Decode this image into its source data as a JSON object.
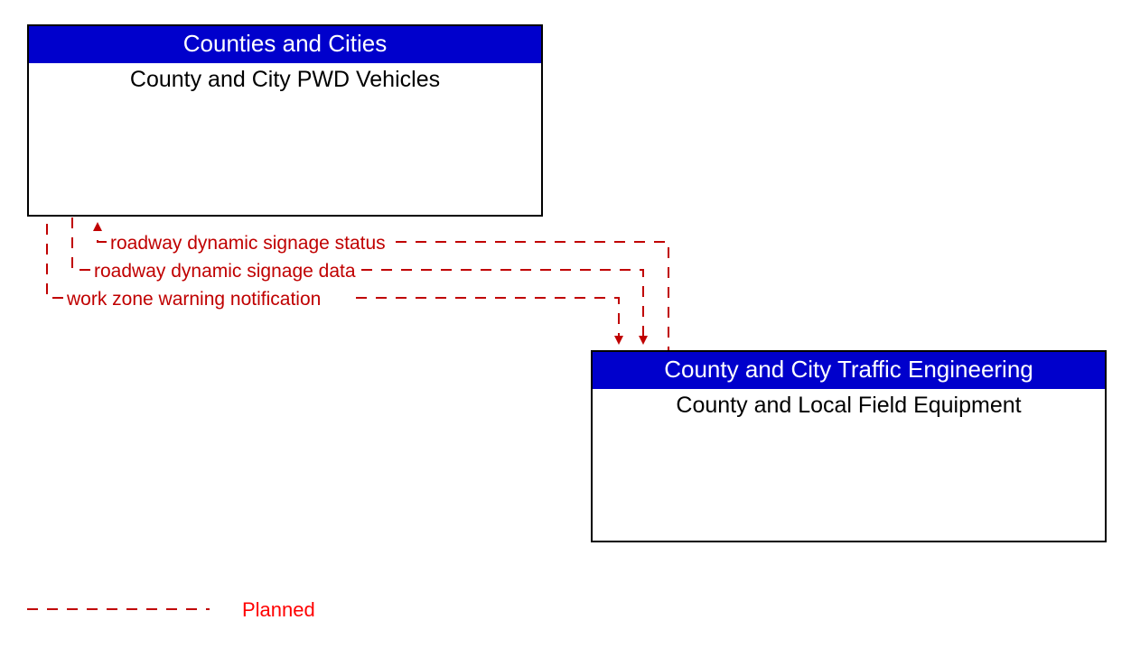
{
  "boxes": {
    "top": {
      "header": "Counties and Cities",
      "body": "County and City PWD Vehicles"
    },
    "bottom": {
      "header": "County and City Traffic Engineering",
      "body": "County and Local Field Equipment"
    }
  },
  "flows": {
    "f1": "roadway dynamic signage status",
    "f2": "roadway dynamic signage data",
    "f3": "work zone warning notification"
  },
  "legend": {
    "planned": "Planned"
  },
  "colors": {
    "header_bg": "#0000cc",
    "planned_line": "#c00000"
  }
}
